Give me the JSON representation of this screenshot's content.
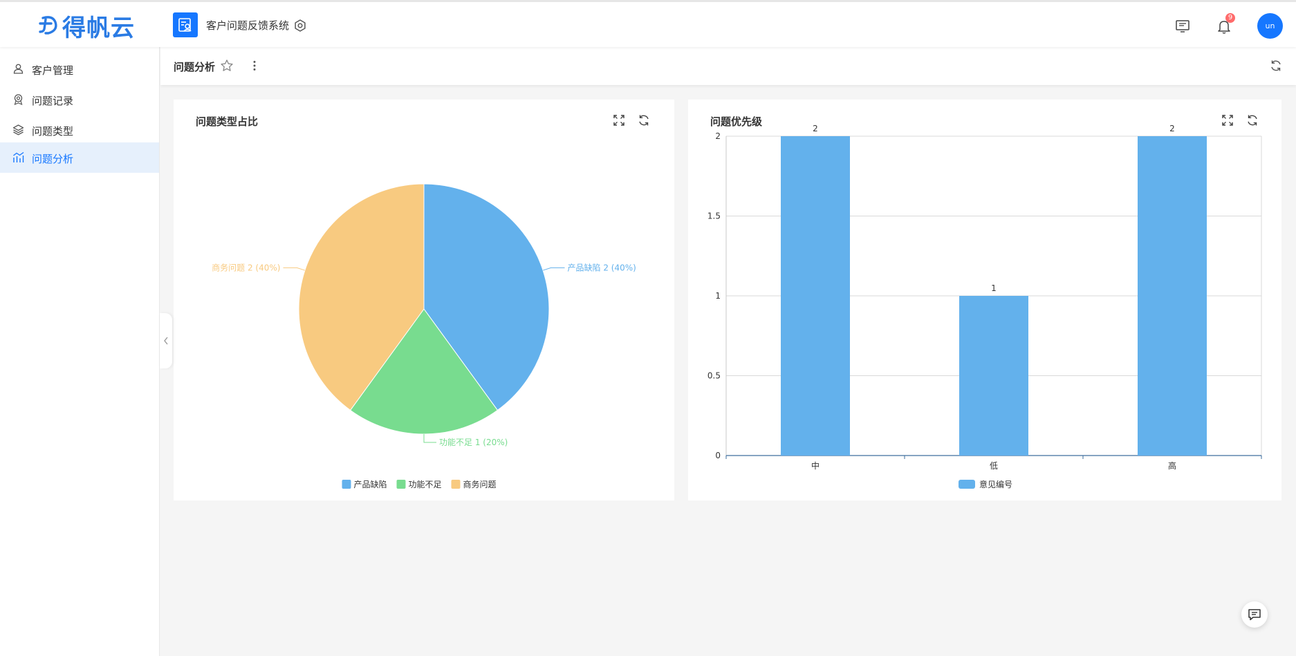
{
  "header": {
    "logo_text": "得帆云",
    "app_title": "客户问题反馈系统",
    "notification_count": "9",
    "avatar_text": "un"
  },
  "sidebar": {
    "items": [
      {
        "label": "客户管理",
        "icon": "user-icon",
        "active": false
      },
      {
        "label": "问题记录",
        "icon": "medal-icon",
        "active": false
      },
      {
        "label": "问题类型",
        "icon": "layers-icon",
        "active": false
      },
      {
        "label": "问题分析",
        "icon": "chart-icon",
        "active": true
      }
    ]
  },
  "page": {
    "title": "问题分析"
  },
  "cards": {
    "pie_title": "问题类型占比",
    "bar_title": "问题优先级"
  },
  "colors": {
    "blue": "#63b1ec",
    "green": "#78dc8f",
    "orange": "#f8ca80",
    "accent": "#1677ff"
  },
  "chart_data": [
    {
      "type": "pie",
      "title": "问题类型占比",
      "slices": [
        {
          "name": "产品缺陷",
          "value": 2,
          "percent": 40,
          "label": "产品缺陷 2 (40%)",
          "color": "#63b1ec"
        },
        {
          "name": "功能不足",
          "value": 1,
          "percent": 20,
          "label": "功能不足 1 (20%)",
          "color": "#78dc8f"
        },
        {
          "name": "商务问题",
          "value": 2,
          "percent": 40,
          "label": "商务问题 2 (40%)",
          "color": "#f8ca80"
        }
      ],
      "legend": [
        "产品缺陷",
        "功能不足",
        "商务问题"
      ],
      "legend_position": "bottom"
    },
    {
      "type": "bar",
      "title": "问题优先级",
      "categories": [
        "中",
        "低",
        "高"
      ],
      "series": [
        {
          "name": "意见编号",
          "values": [
            2,
            1,
            2
          ],
          "color": "#63b1ec"
        }
      ],
      "ylim": [
        0,
        2
      ],
      "yticks": [
        "0",
        "0.5",
        "1",
        "1.5",
        "2"
      ],
      "grid": true,
      "legend_position": "bottom"
    }
  ]
}
